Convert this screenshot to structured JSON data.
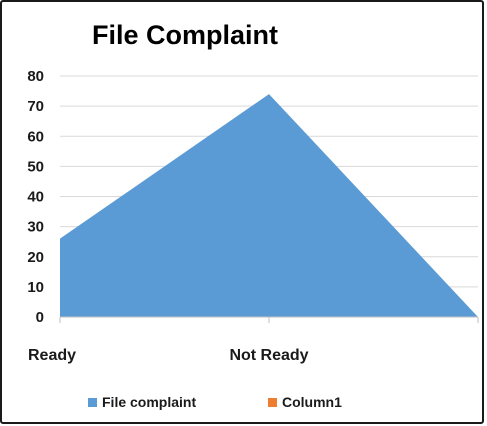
{
  "chart_data": {
    "type": "area",
    "title": "File Complaint",
    "categories": [
      "Ready",
      "Not Ready",
      ""
    ],
    "series": [
      {
        "name": "File complaint",
        "values": [
          26,
          74,
          0
        ],
        "color": "#5b9bd5"
      },
      {
        "name": "Column1",
        "values": [
          null,
          null,
          null
        ],
        "color": "#ed7d31"
      }
    ],
    "ylim": [
      0,
      80
    ],
    "yticks": [
      "0",
      "10",
      "20",
      "30",
      "40",
      "50",
      "60",
      "70",
      "80"
    ],
    "grid": true,
    "legend_position": "bottom"
  }
}
